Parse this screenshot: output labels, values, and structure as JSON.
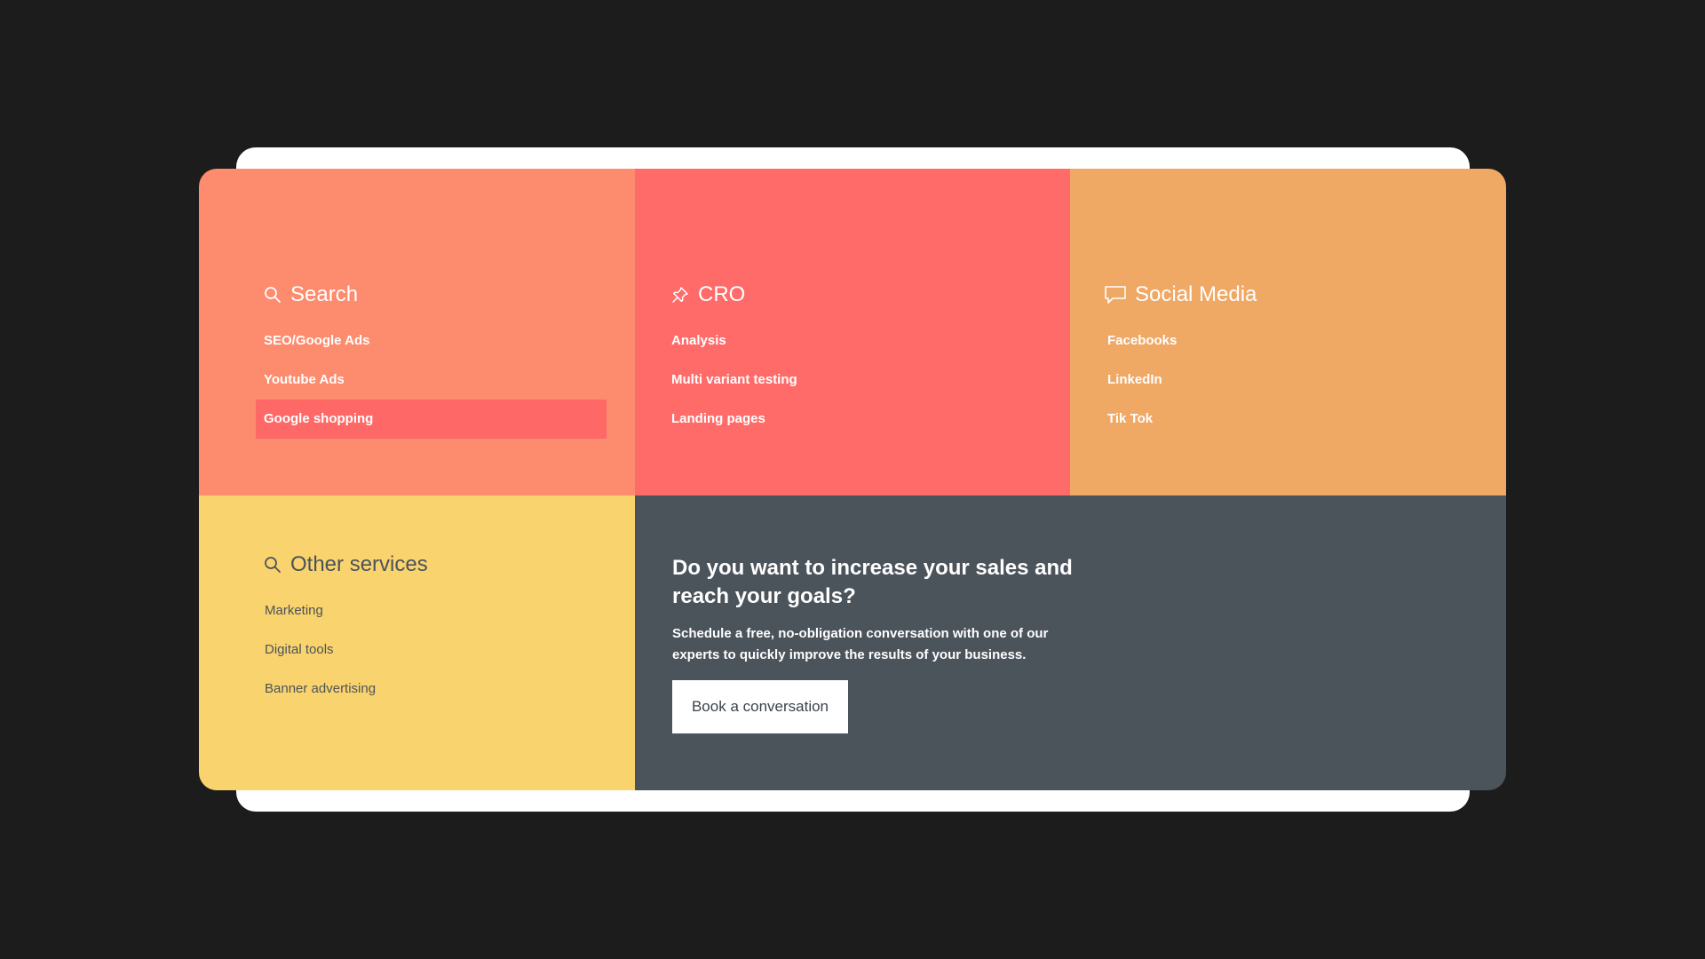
{
  "search": {
    "title": "Search",
    "icon": "search-icon",
    "items": [
      {
        "label": "SEO/Google Ads"
      },
      {
        "label": "Youtube Ads"
      },
      {
        "label": "Google shopping"
      }
    ]
  },
  "cro": {
    "title": "CRO",
    "icon": "pin-icon",
    "items": [
      {
        "label": "Analysis"
      },
      {
        "label": "Multi variant testing"
      },
      {
        "label": "Landing pages"
      }
    ]
  },
  "social": {
    "title": "Social Media",
    "icon": "chat-bubble-icon",
    "items": [
      {
        "label": "Facebooks"
      },
      {
        "label": "LinkedIn"
      },
      {
        "label": "Tik Tok"
      }
    ]
  },
  "other": {
    "title": "Other services",
    "icon": "search-icon",
    "items": [
      {
        "label": "Marketing"
      },
      {
        "label": "Digital tools"
      },
      {
        "label": "Banner advertising"
      }
    ]
  },
  "cta": {
    "title": "Do you want to increase your sales and reach your goals?",
    "text": "Schedule a free, no-obligation conversation with one of our experts to quickly improve the results of your business.",
    "button_label": "Book a conversation"
  },
  "colors": {
    "background": "#1c1c1c",
    "search_tile": "#fd8b6d",
    "cro_tile": "#fe6b69",
    "social_tile": "#f0a865",
    "other_tile": "#f9d36d",
    "cta_tile": "#4b535b",
    "active_item": "#fe6867"
  }
}
